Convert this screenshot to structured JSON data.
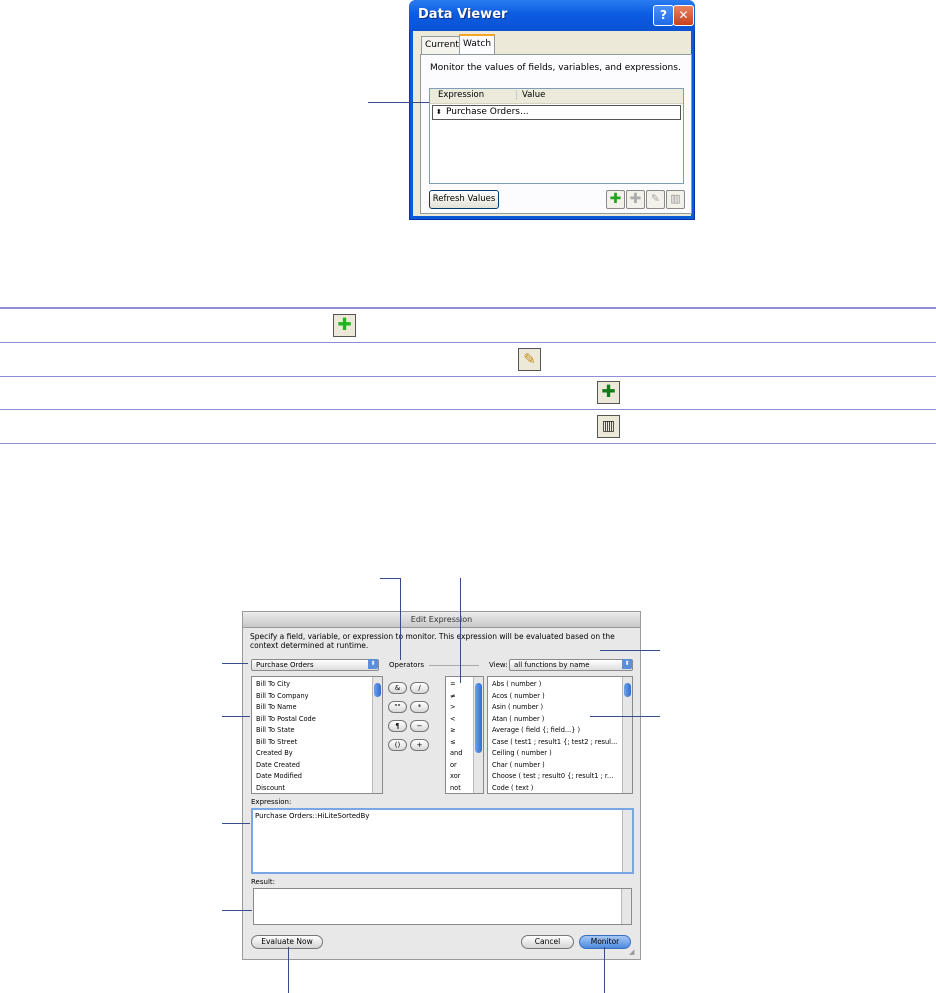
{
  "data_viewer": {
    "title": "Data Viewer",
    "help_glyph": "?",
    "close_glyph": "✕",
    "tabs": [
      "Current",
      "Watch"
    ],
    "description": "Monitor the values of fields, variables, and expressions.",
    "columns": [
      "Expression",
      "Value"
    ],
    "rows": [
      {
        "expression": "Purchase Orders...",
        "value": ""
      }
    ],
    "refresh_label": "Refresh Values",
    "toolbar_icons": [
      "add-expression-icon",
      "duplicate-expression-icon",
      "edit-pencil-icon",
      "delete-trash-icon"
    ]
  },
  "legend_icons": [
    "add-expression-icon",
    "edit-pencil-icon",
    "duplicate-expression-icon",
    "delete-trash-icon"
  ],
  "edit_expression": {
    "title": "Edit Expression",
    "instructions": "Specify a field, variable, or expression to monitor. This expression will be evaluated based on the context determined at runtime.",
    "table_popup": "Purchase Orders",
    "fields": [
      "Bill To City",
      "Bill To Company",
      "Bill To Name",
      "Bill To Postal Code",
      "Bill To State",
      "Bill To Street",
      "Created By",
      "Date Created",
      "Date Modified",
      "Discount"
    ],
    "operators_label": "Operators",
    "operator_buttons": [
      "&",
      "/",
      "\"\"",
      "*",
      "¶",
      "−",
      "()",
      "+"
    ],
    "comparison_operators": [
      "=",
      "≠",
      ">",
      "<",
      "≥",
      "≤",
      "and",
      "or",
      "xor",
      "not"
    ],
    "view_label": "View:",
    "view_popup": "all functions by name",
    "functions": [
      "Abs ( number )",
      "Acos ( number )",
      "Asin ( number )",
      "Atan ( number )",
      "Average ( field {; field...} )",
      "Case ( test1 ; result1 {; test2 ; resul...",
      "Ceiling ( number )",
      "Char ( number )",
      "Choose ( test ; result0 {; result1 ; r...",
      "Code ( text )"
    ],
    "expression_label": "Expression:",
    "expression_value": "Purchase Orders::HiLiteSortedBy",
    "result_label": "Result:",
    "result_value": "",
    "evaluate_label": "Evaluate Now",
    "cancel_label": "Cancel",
    "monitor_label": "Monitor"
  }
}
